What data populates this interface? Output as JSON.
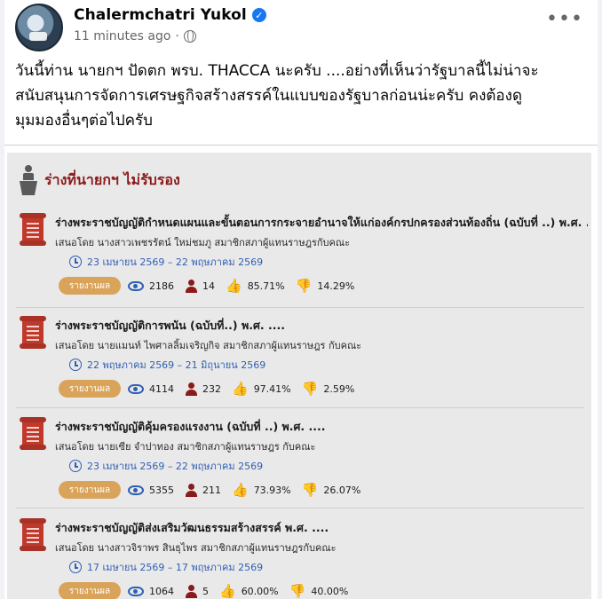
{
  "post": {
    "author": "Chalermchatri Yukol",
    "time": "11 minutes ago",
    "separator": "·",
    "more_label": "•••",
    "text_lines": [
      "วันนี้ท่าน นายกฯ ปัดตก พรบ. THACCA นะครับ ....อย่างที่เห็นว่ารัฐบาลนี้ไม่น่าจะ",
      "สนับสนุนการจัดการเศรษฐกิจสร้างสรรค์ในแบบของรัฐบาลก่อนน่ะครับ คงต้องดู",
      "มุมมองอื่นๆต่อไปครับ"
    ]
  },
  "image": {
    "panel_title": "ร่างที่นายกฯ ไม่รับรอง",
    "report_label": "รายงานผล",
    "bills": [
      {
        "title": "ร่างพระราชบัญญัติกำหนดแผนและขั้นตอนการกระจายอำนาจให้แก่องค์กรปกครองส่วนท้องถิ่น (ฉบับที่ ..) พ.ศ. ....",
        "proposer": "เสนอโดย นางสาวเพชรรัตน์ ใหม่ชมภู สมาชิกสภาผู้แทนราษฎรกับคณะ",
        "dates": "23 เมษายน 2569 – 22 พฤษภาคม 2569",
        "views": "2186",
        "people": "14",
        "agree": "85.71%",
        "disagree": "14.29%"
      },
      {
        "title": "ร่างพระราชบัญญัติการพนัน (ฉบับที่..) พ.ศ. ....",
        "proposer": "เสนอโดย นายแมนท์ ไพศาลลิ้มเจริญกิจ สมาชิกสภาผู้แทนราษฎร กับคณะ",
        "dates": "22 พฤษภาคม 2569 – 21 มิถุนายน 2569",
        "views": "4114",
        "people": "232",
        "agree": "97.41%",
        "disagree": "2.59%"
      },
      {
        "title": "ร่างพระราชบัญญัติคุ้มครองแรงงาน (ฉบับที่ ..) พ.ศ. ....",
        "proposer": "เสนอโดย นายเซีย จำปาทอง สมาชิกสภาผู้แทนราษฎร กับคณะ",
        "dates": "23 เมษายน 2569 – 22 พฤษภาคม 2569",
        "views": "5355",
        "people": "211",
        "agree": "73.93%",
        "disagree": "26.07%"
      },
      {
        "title": "ร่างพระราชบัญญัติส่งเสริมวัฒนธรรมสร้างสรรค์ พ.ศ. ....",
        "proposer": "เสนอโดย นางสาวจิราพร สินธุไพร สมาชิกสภาผู้แทนราษฎรกับคณะ",
        "dates": "17 เมษายน 2569 – 17 พฤษภาคม 2569",
        "views": "1064",
        "people": "5",
        "agree": "60.00%",
        "disagree": "40.00%"
      }
    ]
  },
  "colors": {
    "accent": "#1877f2",
    "panel_title": "#8b1a1a",
    "date_blue": "#2f5fb3",
    "report_button": "#d9a35a",
    "thumb_up": "#2e8b3a",
    "thumb_down": "#c0392b"
  },
  "icons": [
    "avatar",
    "verified-badge-icon",
    "globe-icon",
    "more-options-icon",
    "podium-icon",
    "document-scroll-icon",
    "clock-icon",
    "eye-icon",
    "person-icon",
    "thumb-up-icon",
    "thumb-down-icon"
  ]
}
